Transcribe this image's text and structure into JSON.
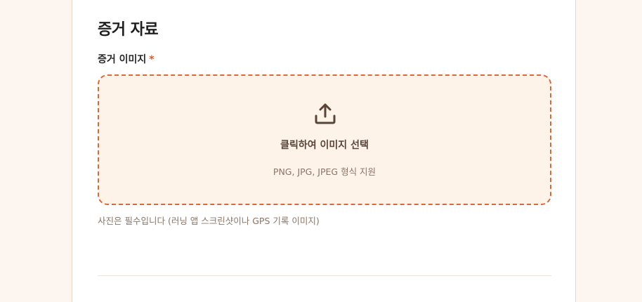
{
  "evidence": {
    "section_title": "증거 자료",
    "image_field": {
      "label": "증거 이미지",
      "required_mark": "*",
      "dropzone_title": "클릭하여 이미지 선택",
      "dropzone_hint": "PNG, JPG, JPEG 형식 지원",
      "icon": "upload-icon",
      "help_text": "사진은 필수입니다 (러닝 앱 스크린샷이나 GPS 기록 이미지)"
    }
  },
  "colors": {
    "accent": "#d9683c",
    "required": "#d9572b",
    "dropzone_bg": "#fdf3e9",
    "page_bg": "#fdf6f0"
  }
}
